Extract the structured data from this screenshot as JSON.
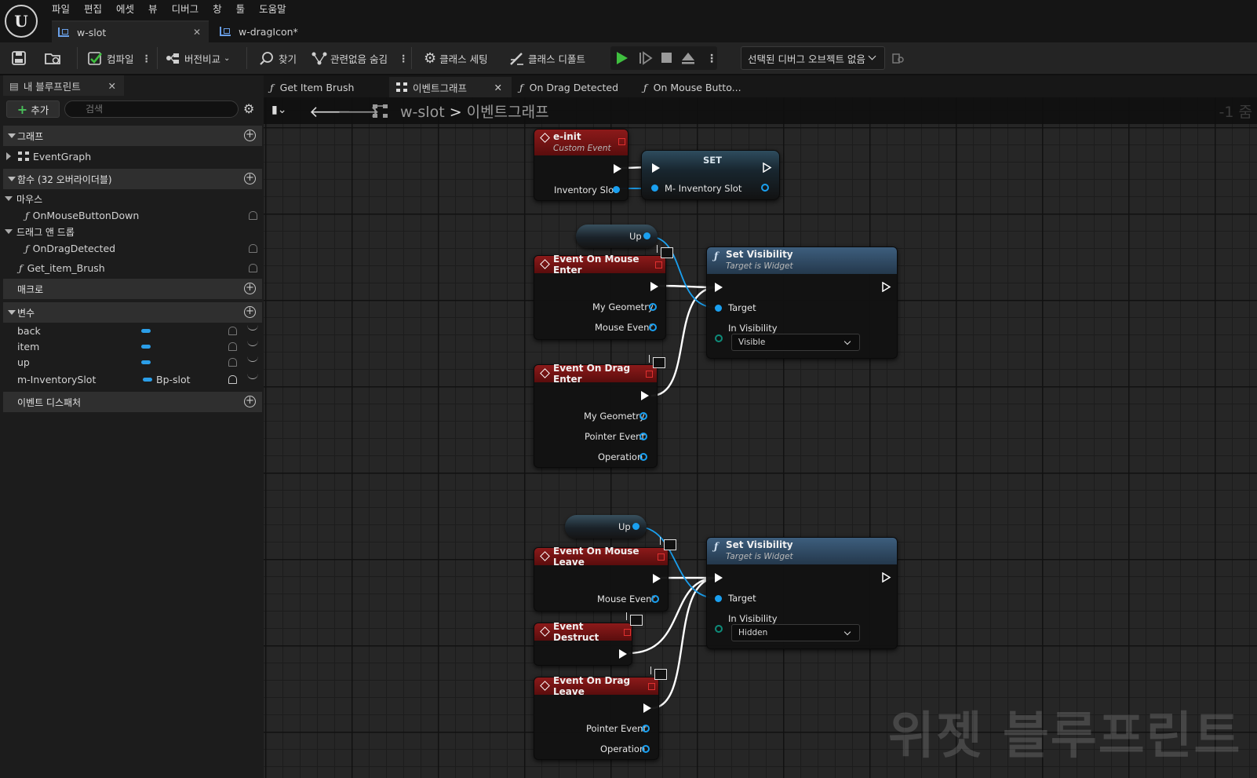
{
  "menu": [
    "파일",
    "편집",
    "에셋",
    "뷰",
    "디버그",
    "창",
    "툴",
    "도움말"
  ],
  "doc_tabs": {
    "active": "w-slot",
    "other": "w-dragIcon*"
  },
  "toolbar": {
    "compile": "컴파일",
    "diff": "버전비교",
    "find": "찾기",
    "hide_unrelated": "관련없음 숨김",
    "class_settings": "클래스 세팅",
    "class_defaults": "클래스 디폴트",
    "debug_object": "선택된 디버그 오브젝트 없음"
  },
  "left_panel": {
    "tab": "내 블루프린트",
    "add": "추가",
    "search_placeholder": "검색",
    "sections": {
      "graphs": "그래프",
      "functions": "함수 (32 오버라이더블)",
      "macros": "매크로",
      "variables": "변수",
      "dispatchers": "이벤트 디스패처"
    },
    "event_graph": "EventGraph",
    "mouse_cat": "마우스",
    "on_mouse_button_down": "OnMouseButtonDown",
    "drag_cat": "드래그 앤 드롭",
    "on_drag_detected": "OnDragDetected",
    "get_item_brush": "Get_item_Brush",
    "variables": [
      {
        "name": "back",
        "type": ""
      },
      {
        "name": "item",
        "type": ""
      },
      {
        "name": "up",
        "type": ""
      },
      {
        "name": "m-InventorySlot",
        "type": "Bp-slot"
      }
    ]
  },
  "graph_tabs": [
    "Get Item Brush",
    "이벤트그래프",
    "On Drag Detected",
    "On Mouse Butto..."
  ],
  "breadcrumb": {
    "root": "w-slot",
    "sep": ">",
    "current": "이벤트그래프"
  },
  "zoom": "-1 줌",
  "watermark": "위젯 블루프린트",
  "nodes": {
    "einit": {
      "title": "e-init",
      "subtitle": "Custom Event",
      "pin": "Inventory Slot"
    },
    "set": {
      "title": "SET",
      "pin": "M- Inventory Slot"
    },
    "up_a": "Up",
    "up_b": "Up",
    "mouse_enter": {
      "title": "Event On Mouse Enter",
      "pins": [
        "My Geometry",
        "Mouse Event"
      ]
    },
    "drag_enter": {
      "title": "Event On Drag Enter",
      "pins": [
        "My Geometry",
        "Pointer Event",
        "Operation"
      ]
    },
    "setvis_a": {
      "title": "Set Visibility",
      "subtitle": "Target is Widget",
      "target": "Target",
      "in_vis": "In Visibility",
      "value": "Visible"
    },
    "mouse_leave": {
      "title": "Event On Mouse Leave",
      "pin": "Mouse Event"
    },
    "destruct": {
      "title": "Event Destruct"
    },
    "drag_leave": {
      "title": "Event On Drag Leave",
      "pins": [
        "Pointer Event",
        "Operation"
      ]
    },
    "setvis_b": {
      "title": "Set Visibility",
      "subtitle": "Target is Widget",
      "target": "Target",
      "in_vis": "In Visibility",
      "value": "Hidden"
    }
  },
  "colors": {
    "event_header": "#8c1a1a",
    "function_header": "#3d5e7d",
    "object_pin": "#1aa0f0",
    "play": "#3fbf3f"
  }
}
